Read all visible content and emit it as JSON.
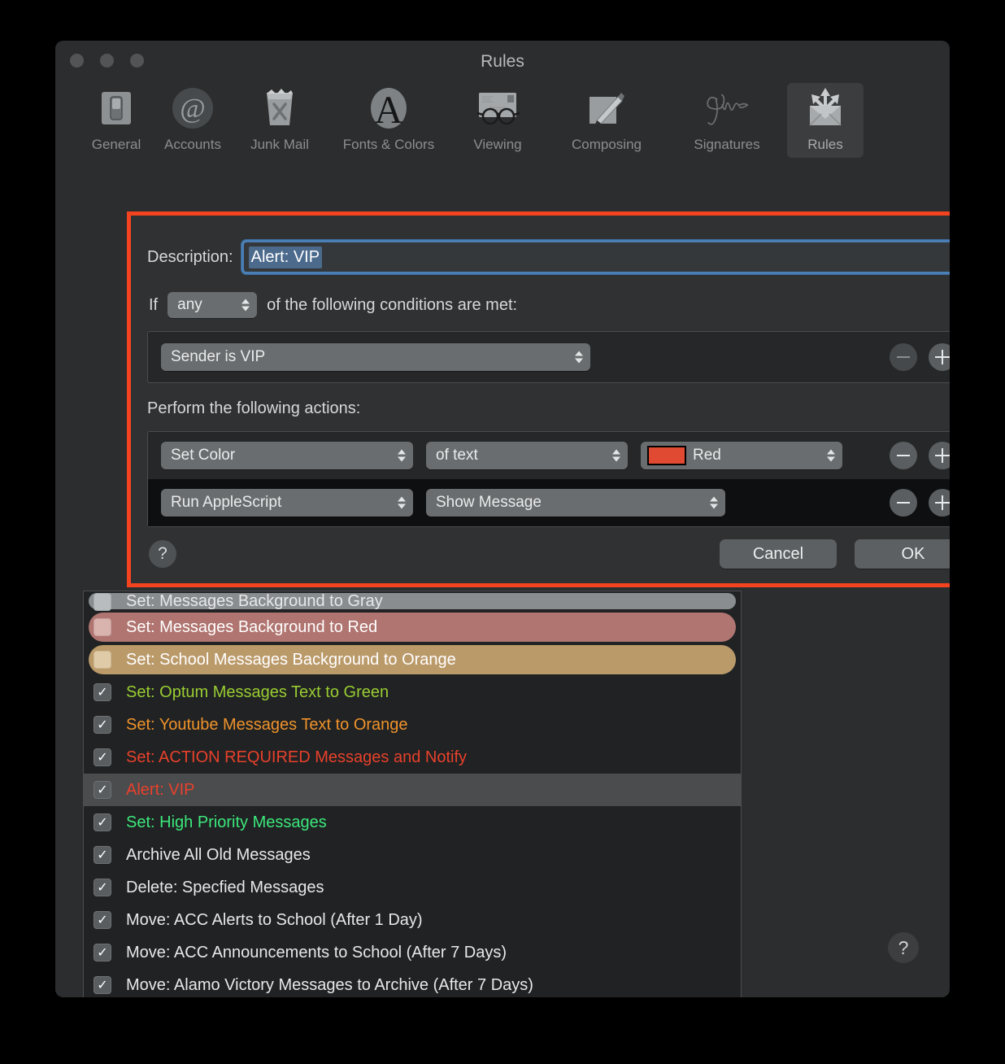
{
  "window": {
    "title": "Rules",
    "traffic_lights": [
      "close",
      "minimize",
      "zoom"
    ]
  },
  "toolbar": {
    "items": [
      {
        "label": "General",
        "icon": "switch-icon",
        "selected": false
      },
      {
        "label": "Accounts",
        "icon": "at-sign-icon",
        "selected": false
      },
      {
        "label": "Junk Mail",
        "icon": "trash-x-icon",
        "selected": false
      },
      {
        "label": "Fonts & Colors",
        "icon": "letter-a-icon",
        "selected": false
      },
      {
        "label": "Viewing",
        "icon": "glasses-icon",
        "selected": false
      },
      {
        "label": "Composing",
        "icon": "pencil-pad-icon",
        "selected": false
      },
      {
        "label": "Signatures",
        "icon": "signature-icon",
        "selected": false
      },
      {
        "label": "Rules",
        "icon": "rules-icon",
        "selected": true
      }
    ]
  },
  "sheet": {
    "highlight_color": "#f4441f",
    "description_label": "Description:",
    "description_value": "Alert: VIP",
    "if_label": "If",
    "match_selector": "any",
    "conditions_label": "of the following conditions are met:",
    "conditions": [
      {
        "criterion": "Sender is VIP",
        "minus_enabled": false,
        "plus_enabled": true
      }
    ],
    "actions_label": "Perform the following actions:",
    "actions": [
      {
        "verb": "Set Color",
        "target": "of text",
        "value": "Red",
        "swatch_color": "#e04a32",
        "has_swatch": true
      },
      {
        "verb": "Run AppleScript",
        "target": "Show Message",
        "value": null,
        "swatch_color": null,
        "has_swatch": false
      }
    ],
    "help_label": "?",
    "cancel_label": "Cancel",
    "ok_label": "OK"
  },
  "rules_list": {
    "help_label": "?",
    "rows": [
      {
        "text": "Set: Messages Background to Gray",
        "text_color": "#e6e8e9",
        "style": "pill",
        "pill_color": "#8a8d90",
        "checkbox": "plain-gray",
        "selected": false,
        "clipped": true
      },
      {
        "text": "Set: Messages Background to Red",
        "text_color": "#ffffff",
        "style": "pill",
        "pill_color": "#b07570",
        "checkbox": "plain-red",
        "selected": false,
        "clipped": false
      },
      {
        "text": "Set: School Messages Background to Orange",
        "text_color": "#ffffff",
        "style": "pill",
        "pill_color": "#bb9a6a",
        "checkbox": "plain-orng",
        "selected": false,
        "clipped": false
      },
      {
        "text": "Set: Optum Messages Text to Green",
        "text_color": "#9acd32",
        "style": "plain",
        "pill_color": null,
        "checkbox": "checked",
        "selected": false,
        "clipped": false
      },
      {
        "text": "Set: Youtube Messages Text to Orange",
        "text_color": "#f0932b",
        "style": "plain",
        "pill_color": null,
        "checkbox": "checked",
        "selected": false,
        "clipped": false
      },
      {
        "text": "Set: ACTION REQUIRED Messages and Notify",
        "text_color": "#e8412b",
        "style": "plain",
        "pill_color": null,
        "checkbox": "checked",
        "selected": false,
        "clipped": false
      },
      {
        "text": "Alert: VIP",
        "text_color": "#e8412b",
        "style": "plain",
        "pill_color": null,
        "checkbox": "checked",
        "selected": true,
        "clipped": false
      },
      {
        "text": "Set: High Priority Messages",
        "text_color": "#3ce87c",
        "style": "plain",
        "pill_color": null,
        "checkbox": "checked",
        "selected": false,
        "clipped": false
      },
      {
        "text": "Archive All Old Messages",
        "text_color": "#e6e8e9",
        "style": "plain",
        "pill_color": null,
        "checkbox": "checked",
        "selected": false,
        "clipped": false
      },
      {
        "text": "Delete: Specfied Messages",
        "text_color": "#e6e8e9",
        "style": "plain",
        "pill_color": null,
        "checkbox": "checked",
        "selected": false,
        "clipped": false
      },
      {
        "text": "Move: ACC Alerts to School (After 1 Day)",
        "text_color": "#e6e8e9",
        "style": "plain",
        "pill_color": null,
        "checkbox": "checked",
        "selected": false,
        "clipped": false
      },
      {
        "text": "Move: ACC Announcements to School (After 7 Days)",
        "text_color": "#e6e8e9",
        "style": "plain",
        "pill_color": null,
        "checkbox": "checked",
        "selected": false,
        "clipped": false
      },
      {
        "text": "Move: Alamo Victory Messages to Archive (After 7 Days)",
        "text_color": "#e6e8e9",
        "style": "plain",
        "pill_color": null,
        "checkbox": "checked",
        "selected": false,
        "clipped": false
      }
    ]
  }
}
